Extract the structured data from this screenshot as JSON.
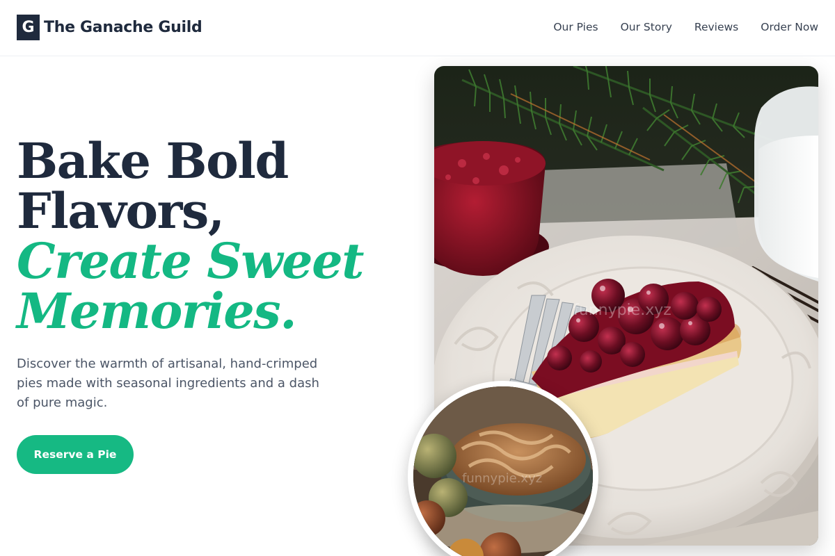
{
  "brand": {
    "logo_letter": "G",
    "name": "The Ganache Guild"
  },
  "nav": {
    "items": [
      {
        "label": "Our Pies"
      },
      {
        "label": "Our Story"
      },
      {
        "label": "Reviews"
      },
      {
        "label": "Order Now"
      }
    ]
  },
  "hero": {
    "headline_line1": "Bake Bold",
    "headline_line2": "Flavors,",
    "headline_accent_line1": "Create Sweet",
    "headline_accent_line2": "Memories.",
    "description": "Discover the warmth of artisanal, hand-crimped pies made with seasonal ingredients and a dash of pure magic.",
    "cta_label": "Reserve a Pie"
  },
  "images": {
    "main_watermark": "funnypie.xyz",
    "circle_watermark": "funnypie.xyz"
  },
  "colors": {
    "primary_dark": "#1f2a3d",
    "accent_green": "#14b883",
    "body_text": "#4b5566"
  }
}
